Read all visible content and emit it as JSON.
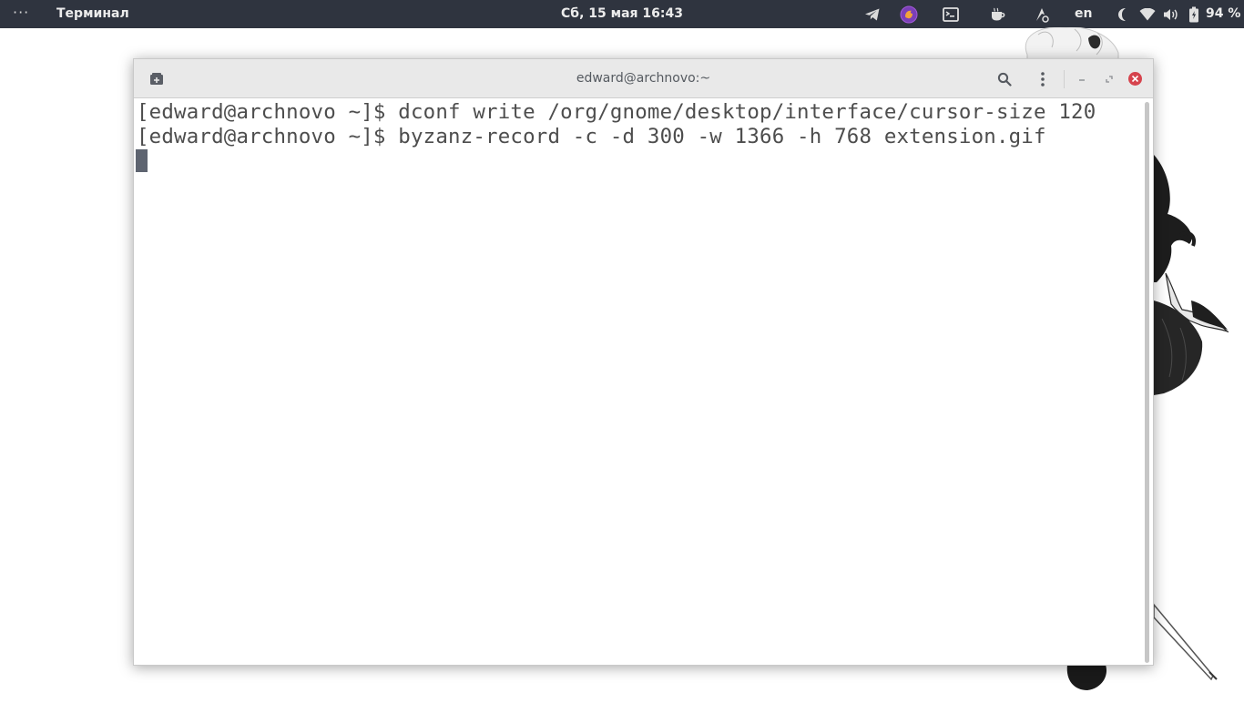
{
  "topbar": {
    "activities_icon": "dots-menu-icon",
    "app_name": "Терминал",
    "clock": "Сб, 15 мая  16:43",
    "tray_icons": [
      "telegram-icon",
      "firefox-icon",
      "terminal-indicator-icon",
      "coffee-icon",
      "accessibility-icon"
    ],
    "language": "en",
    "night_light_icon": "moon-icon",
    "wifi_icon": "wifi-icon",
    "volume_icon": "volume-icon",
    "battery_icon": "battery-icon",
    "battery_percent": "94 %"
  },
  "window": {
    "title": "edward@archnovo:~",
    "buttons": [
      "new-tab-icon",
      "search-icon",
      "menu-icon",
      "minimize-icon",
      "maximize-icon",
      "close-icon"
    ],
    "close_color": "#d6434d"
  },
  "terminal": {
    "lines": [
      "[edward@archnovo ~]$ dconf write /org/gnome/desktop/interface/cursor-size 120",
      "[edward@archnovo ~]$ byzanz-record -c -d 300 -w 1366 -h 768 extension.gif"
    ],
    "text_color": "#4d4d4d",
    "background": "#ffffff"
  },
  "colors": {
    "topbar_bg": "#2f343f",
    "titlebar_bg": "#e9e9e9",
    "cursor": "#5e6470"
  }
}
